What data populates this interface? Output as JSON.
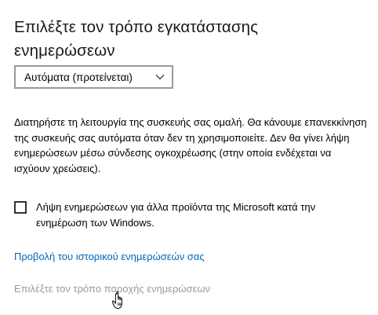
{
  "header": {
    "title": "Επιλέξτε τον τρόπο εγκατάστασης ενημερώσεων"
  },
  "install_mode": {
    "selected": "Αυτόματα (προτείνεται)",
    "chevron_icon": "chevron-down-icon"
  },
  "description": {
    "text": "Διατηρήστε τη λειτουργία της συσκευής σας ομαλή. Θα κάνουμε επανεκκίνηση της συσκευής σας αυτόματα όταν δεν τη χρησιμοποιείτε. Δεν θα γίνει λήψη ενημερώσεων μέσω σύνδεσης ογκοχρέωσης (στην οποία ενδέχεται να ισχύουν χρεώσεις)."
  },
  "other_products": {
    "label": "Λήψη ενημερώσεων για άλλα προϊόντα της Microsoft κατά την ενημέρωση των Windows.",
    "checked": false
  },
  "links": {
    "history": "Προβολή του ιστορικού ενημερώσεών σας",
    "delivery": "Επιλέξτε τον τρόπο παροχής ενημερώσεων"
  },
  "colors": {
    "link": "#0067b8",
    "link_hover_disabled": "#9a9a9a",
    "dropdown_border": "#999999"
  },
  "cursor": {
    "icon": "hand-pointer-icon"
  }
}
